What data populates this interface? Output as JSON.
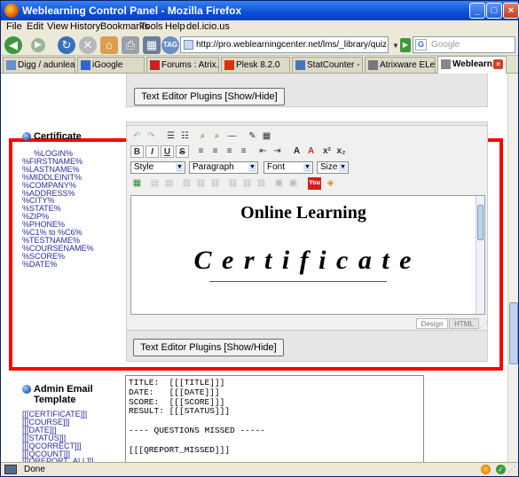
{
  "window": {
    "title": "Weblearning Control Panel - Mozilla Firefox",
    "buttons": [
      "_",
      "□",
      "×"
    ]
  },
  "menubar": [
    "File",
    "Edit",
    "View",
    "History",
    "Bookmarks",
    "Tools",
    "Help",
    "del.icio.us"
  ],
  "navbar": {
    "url": "http://pro.weblearningcenter.net/lms/_library/quiz_properties.p",
    "search_placeholder": "Google",
    "tag_label": "TAG"
  },
  "tabs": [
    {
      "label": "Digg / adunleavy",
      "active": false,
      "icon_color": "#6b8fc9"
    },
    {
      "label": "iGoogle",
      "active": false,
      "icon_color": "#3366cc"
    },
    {
      "label": "Forums : Atrix...",
      "active": false,
      "icon_color": "#cc2222"
    },
    {
      "label": "Plesk 8.2.0",
      "active": false,
      "icon_color": "#dd3300"
    },
    {
      "label": "StatCounter - ...",
      "active": false,
      "icon_color": "#4477bb"
    },
    {
      "label": "Atrixware ELe...",
      "active": false,
      "icon_color": "#777777"
    },
    {
      "label": "Weblearn...",
      "active": true,
      "icon_color": "#888888"
    }
  ],
  "content": {
    "top_plugins_label": "Text Editor Plugins [Show/Hide]",
    "bottom_plugins_label": "Text Editor Plugins [Show/Hide]",
    "certificate": {
      "heading": "Certificate",
      "tokens": [
        "%LOGIN%",
        "%FIRSTNAME%",
        "%LASTNAME%",
        "%MIDDLEINIT%",
        "%COMPANY%",
        "%ADDRESS%",
        "%CITY%",
        "%STATE%",
        "%ZIP%",
        "%PHONE%",
        "%C1% to %C6%",
        "%TESTNAME%",
        "%COURSENAME%",
        "%SCORE%",
        "%DATE%"
      ]
    },
    "editor": {
      "style_select": "Style",
      "paragraph_select": "Paragraph",
      "font_select": "Font",
      "size_select": "Size",
      "doc_line1": "Online Learning",
      "doc_line2": "C e r t i f i c a t e",
      "tab_design": "Design",
      "tab_html": "HTML"
    },
    "admin_email": {
      "heading_line1": "Admin Email",
      "heading_line2": "Template",
      "tokens": [
        "[[[CERTIFICATE]]]",
        "[[[COURSE]]]",
        "[[[DATE]]]",
        "[[[STATUS]]]",
        "[[[QCORRECT]]]",
        "[[[QCOUNT]]]",
        "[[[QREPORT_ALL]]]"
      ],
      "template_lines": [
        "TITLE:  [[[TITLE]]]",
        "DATE:   [[[DATE]]]",
        "SCORE:  [[[SCORE]]]",
        "RESULT: [[[STATUS]]]",
        "",
        "---- QUESTIONS MISSED -----",
        "",
        "[[[QREPORT_MISSED]]]"
      ]
    }
  },
  "statusbar": {
    "text": "Done"
  },
  "colors": {
    "highlight_border": "#ff0000",
    "token_text": "#2a2aa0",
    "titlebar": "#0a4fd6"
  }
}
